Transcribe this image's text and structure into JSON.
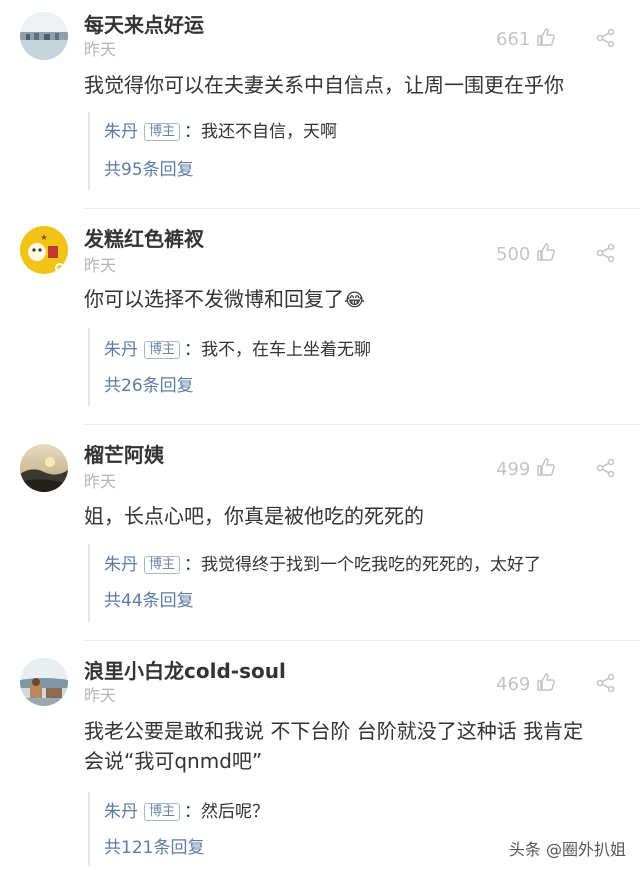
{
  "comments": [
    {
      "username": "每天来点好运",
      "time": "昨天",
      "likes": "661",
      "text": "我觉得你可以在夫妻关系中自信点，让周一围更在乎你",
      "reply": {
        "author": "朱丹",
        "badge": "博主",
        "text": "：我还不自信，天啊",
        "count": "共95条回复"
      }
    },
    {
      "username": "发糕红色裤衩",
      "time": "昨天",
      "likes": "500",
      "text": "你可以选择不发微博和回复了",
      "emoji": "😂",
      "reply": {
        "author": "朱丹",
        "badge": "博主",
        "text": "：我不，在车上坐着无聊",
        "count": "共26条回复"
      }
    },
    {
      "username": "榴芒阿姨",
      "time": "昨天",
      "likes": "499",
      "text": "姐，长点心吧，你真是被他吃的死死的",
      "reply": {
        "author": "朱丹",
        "badge": "博主",
        "text": "：我觉得终于找到一个吃我吃的死死的，太好了",
        "count": "共44条回复"
      }
    },
    {
      "username": "浪里小白龙cold-soul",
      "time": "昨天",
      "likes": "469",
      "text_line1": "我老公要是敢和我说 不下台阶 台阶就没了这种话 我肯定",
      "text_line2": "会说“我可qnmd吧”",
      "reply": {
        "author": "朱丹",
        "badge": "博主",
        "text": "：然后呢？",
        "count": "共121条回复"
      }
    }
  ],
  "watermark": {
    "text": "头条 @圈外扒姐"
  },
  "icons": {
    "like": "thumbs-up-icon",
    "share": "share-icon"
  },
  "colors": {
    "link": "#5b7da8",
    "muted": "#b5b5b5",
    "text": "#333333"
  }
}
